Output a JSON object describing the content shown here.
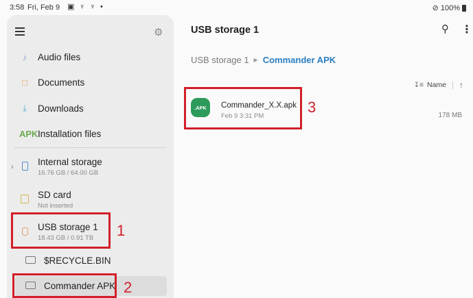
{
  "status_bar": {
    "time": "3:58",
    "date": "Fri, Feb 9",
    "notification_icons": "▣ ♆ ♆ •",
    "battery": "100%"
  },
  "sidebar": {
    "items": [
      {
        "label": "Audio files",
        "icon": "music-note-icon"
      },
      {
        "label": "Documents",
        "icon": "document-icon"
      },
      {
        "label": "Downloads",
        "icon": "download-icon"
      },
      {
        "label": "Installation files",
        "icon": "apk-icon",
        "icon_text": "APK"
      }
    ],
    "storage": [
      {
        "label": "Internal storage",
        "sub": "16.76 GB / 64.00 GB",
        "icon": "phone-storage-icon"
      },
      {
        "label": "SD card",
        "sub": "Not inserted",
        "icon": "sd-card-icon"
      },
      {
        "label": "USB storage 1",
        "sub": "18.43 GB / 0.91 TB",
        "icon": "usb-icon"
      }
    ],
    "folders": [
      {
        "label": "$RECYCLE.BIN"
      },
      {
        "label": "Commander APK"
      }
    ]
  },
  "main": {
    "title": "USB storage 1",
    "breadcrumb": [
      "USB storage 1",
      "Commander APK"
    ],
    "sort_label": "Name",
    "file": {
      "badge": ".APK",
      "name": "Commander_X.X.apk",
      "date": "Feb 9 3:31 PM",
      "size": "178 MB"
    }
  },
  "annotations": [
    "1",
    "2",
    "3"
  ],
  "colors": {
    "accent": "#2a7ec1",
    "annotation_red": "#d11f2a",
    "apk_green": "#2e9a5b"
  }
}
